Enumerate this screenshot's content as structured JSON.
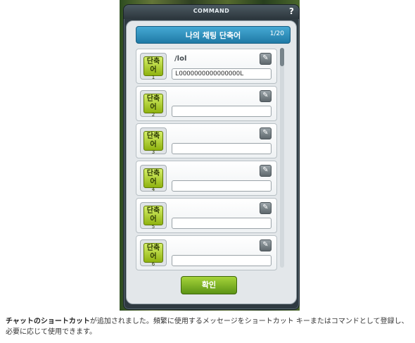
{
  "window": {
    "title": "COMMAND",
    "help_label": "?"
  },
  "header": {
    "title": "나의 채팅 단축어",
    "count": "1/20"
  },
  "slots": [
    {
      "badge_text": "단축어",
      "badge_number": "1",
      "name": "/lol",
      "value": "LOOOOOOOOOOOOOOOOL",
      "edit_icon": "pencil-icon"
    },
    {
      "badge_text": "단축어",
      "badge_number": "2",
      "name": "",
      "value": "",
      "edit_icon": "pencil-icon"
    },
    {
      "badge_text": "단축어",
      "badge_number": "3",
      "name": "",
      "value": "",
      "edit_icon": "pencil-icon"
    },
    {
      "badge_text": "단축어",
      "badge_number": "4",
      "name": "",
      "value": "",
      "edit_icon": "pencil-icon"
    },
    {
      "badge_text": "단축어",
      "badge_number": "5",
      "name": "",
      "value": "",
      "edit_icon": "pencil-icon"
    },
    {
      "badge_text": "단축어",
      "badge_number": "6",
      "name": "",
      "value": "",
      "edit_icon": "pencil-icon"
    }
  ],
  "confirm_button": {
    "label": "확인"
  },
  "caption": {
    "bold": "チャットのショートカット",
    "text": "が追加されました。頻繁に使用するメッセージをショートカット キーまたはコマンドとして登録し、必要に応じて使用できます。"
  },
  "colors": {
    "header_blue": "#2a8fbf",
    "badge_green": "#9cc41a",
    "confirm_green": "#6fa51d"
  }
}
